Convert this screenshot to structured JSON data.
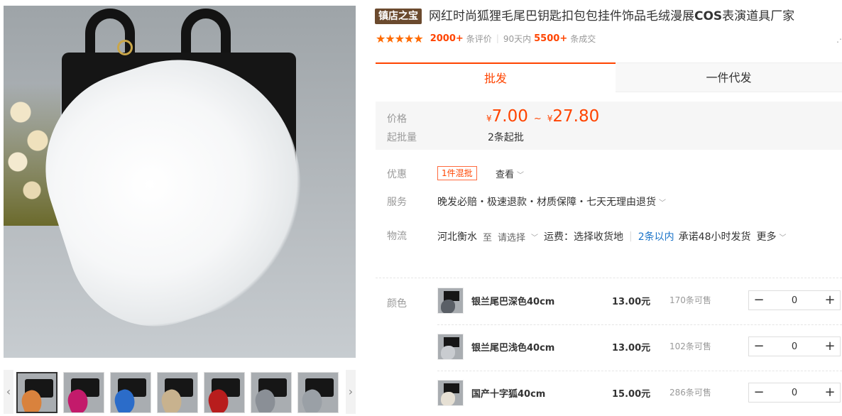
{
  "gallery": {
    "prev_icon": "chevron-left-icon",
    "next_icon": "chevron-right-icon",
    "thumbs": [
      {
        "tail_color": "#d9823d"
      },
      {
        "tail_color": "#c31a6b"
      },
      {
        "tail_color": "#2b6cc9"
      },
      {
        "tail_color": "#c8b28e"
      },
      {
        "tail_color": "#b81d1d"
      },
      {
        "tail_color": "#8a8f96"
      },
      {
        "tail_color": "#9aa0a6"
      }
    ]
  },
  "product": {
    "badge": "镇店之宝",
    "title_prefix": "网红时尚狐狸毛尾巴钥匙扣包包挂件饰品毛绒漫展",
    "title_bold": "COS",
    "title_suffix": "表演道具厂家"
  },
  "rating": {
    "stars": "★★★★★",
    "review_count": "2000+",
    "review_label": "条评价",
    "sales_period": "90天内",
    "sales_count": "5500+",
    "sales_label": "条成交"
  },
  "tabs": {
    "wholesale": "批发",
    "dropship": "一件代发"
  },
  "price": {
    "label": "价格",
    "currency": "¥",
    "min": "7.00",
    "sep": "~",
    "max": "27.80",
    "moq_label": "起批量",
    "moq_value": "2条起批"
  },
  "promo": {
    "label": "优惠",
    "tag": "1件混批",
    "link": "查看"
  },
  "service": {
    "label": "服务",
    "value": "晚发必赔・极速退款・材质保障・七天无理由退货"
  },
  "logistics": {
    "label": "物流",
    "origin": "河北衡水",
    "to": "至",
    "dest": "请选择",
    "fee": "运费：选择收货地",
    "eta": "2条以内",
    "promise": "承诺48小时发货",
    "more": "更多"
  },
  "skus": {
    "label": "颜色",
    "items": [
      {
        "name": "银兰尾巴深色40cm",
        "price": "13.00元",
        "stock": "170条可售",
        "qty": "0",
        "tail_color": "#5a5f66"
      },
      {
        "name": "银兰尾巴浅色40cm",
        "price": "13.00元",
        "stock": "102条可售",
        "qty": "0",
        "tail_color": "#c9ccd0"
      },
      {
        "name": "国产十字狐40cm",
        "price": "15.00元",
        "stock": "286条可售",
        "qty": "0",
        "tail_color": "#e6e0d4"
      }
    ]
  },
  "colors": {
    "accent": "#ff4400",
    "badge_bg": "#6b4a2e",
    "link_blue": "#1a73c8"
  }
}
